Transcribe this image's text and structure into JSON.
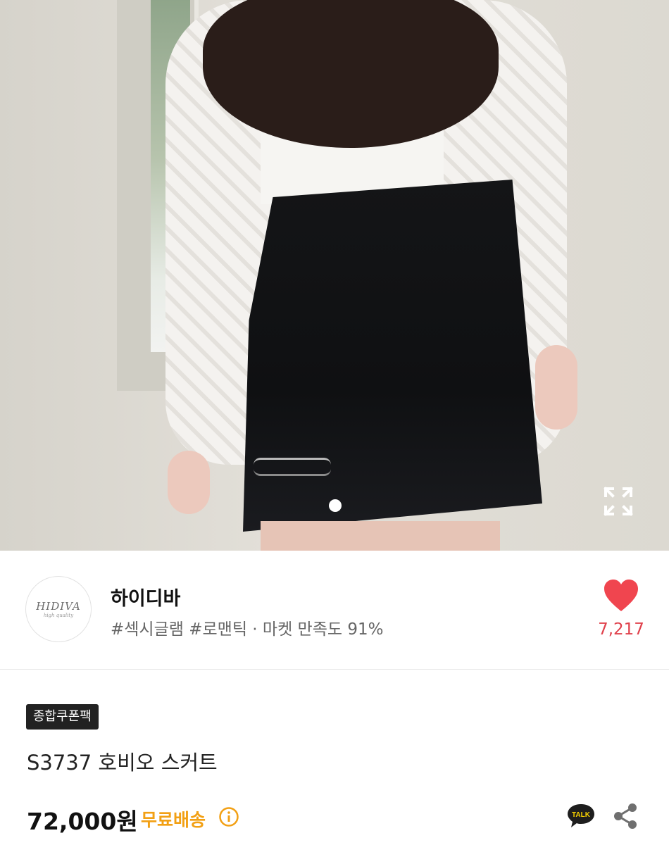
{
  "seller": {
    "logo_line1": "HIDIVA",
    "logo_line2": "high quality",
    "name": "하이디바",
    "tags": "#섹시글램 #로맨틱 · 마켓 만족도 91%",
    "like_count": "7,217"
  },
  "product": {
    "badge": "종합쿠폰팩",
    "title": "S3737 호비오 스커트",
    "price": "72,000원",
    "shipping": "무료배송"
  },
  "actions": {
    "talk_label": "TALK"
  },
  "colors": {
    "like": "#f0454f",
    "shipping": "#f2a014",
    "badge_bg": "#222222",
    "talk_bg": "#1e1e1e"
  },
  "icons": [
    "expand-icon",
    "heart-icon",
    "info-icon",
    "talk-icon",
    "share-icon"
  ],
  "pager": {
    "current": 1,
    "total": 1
  }
}
